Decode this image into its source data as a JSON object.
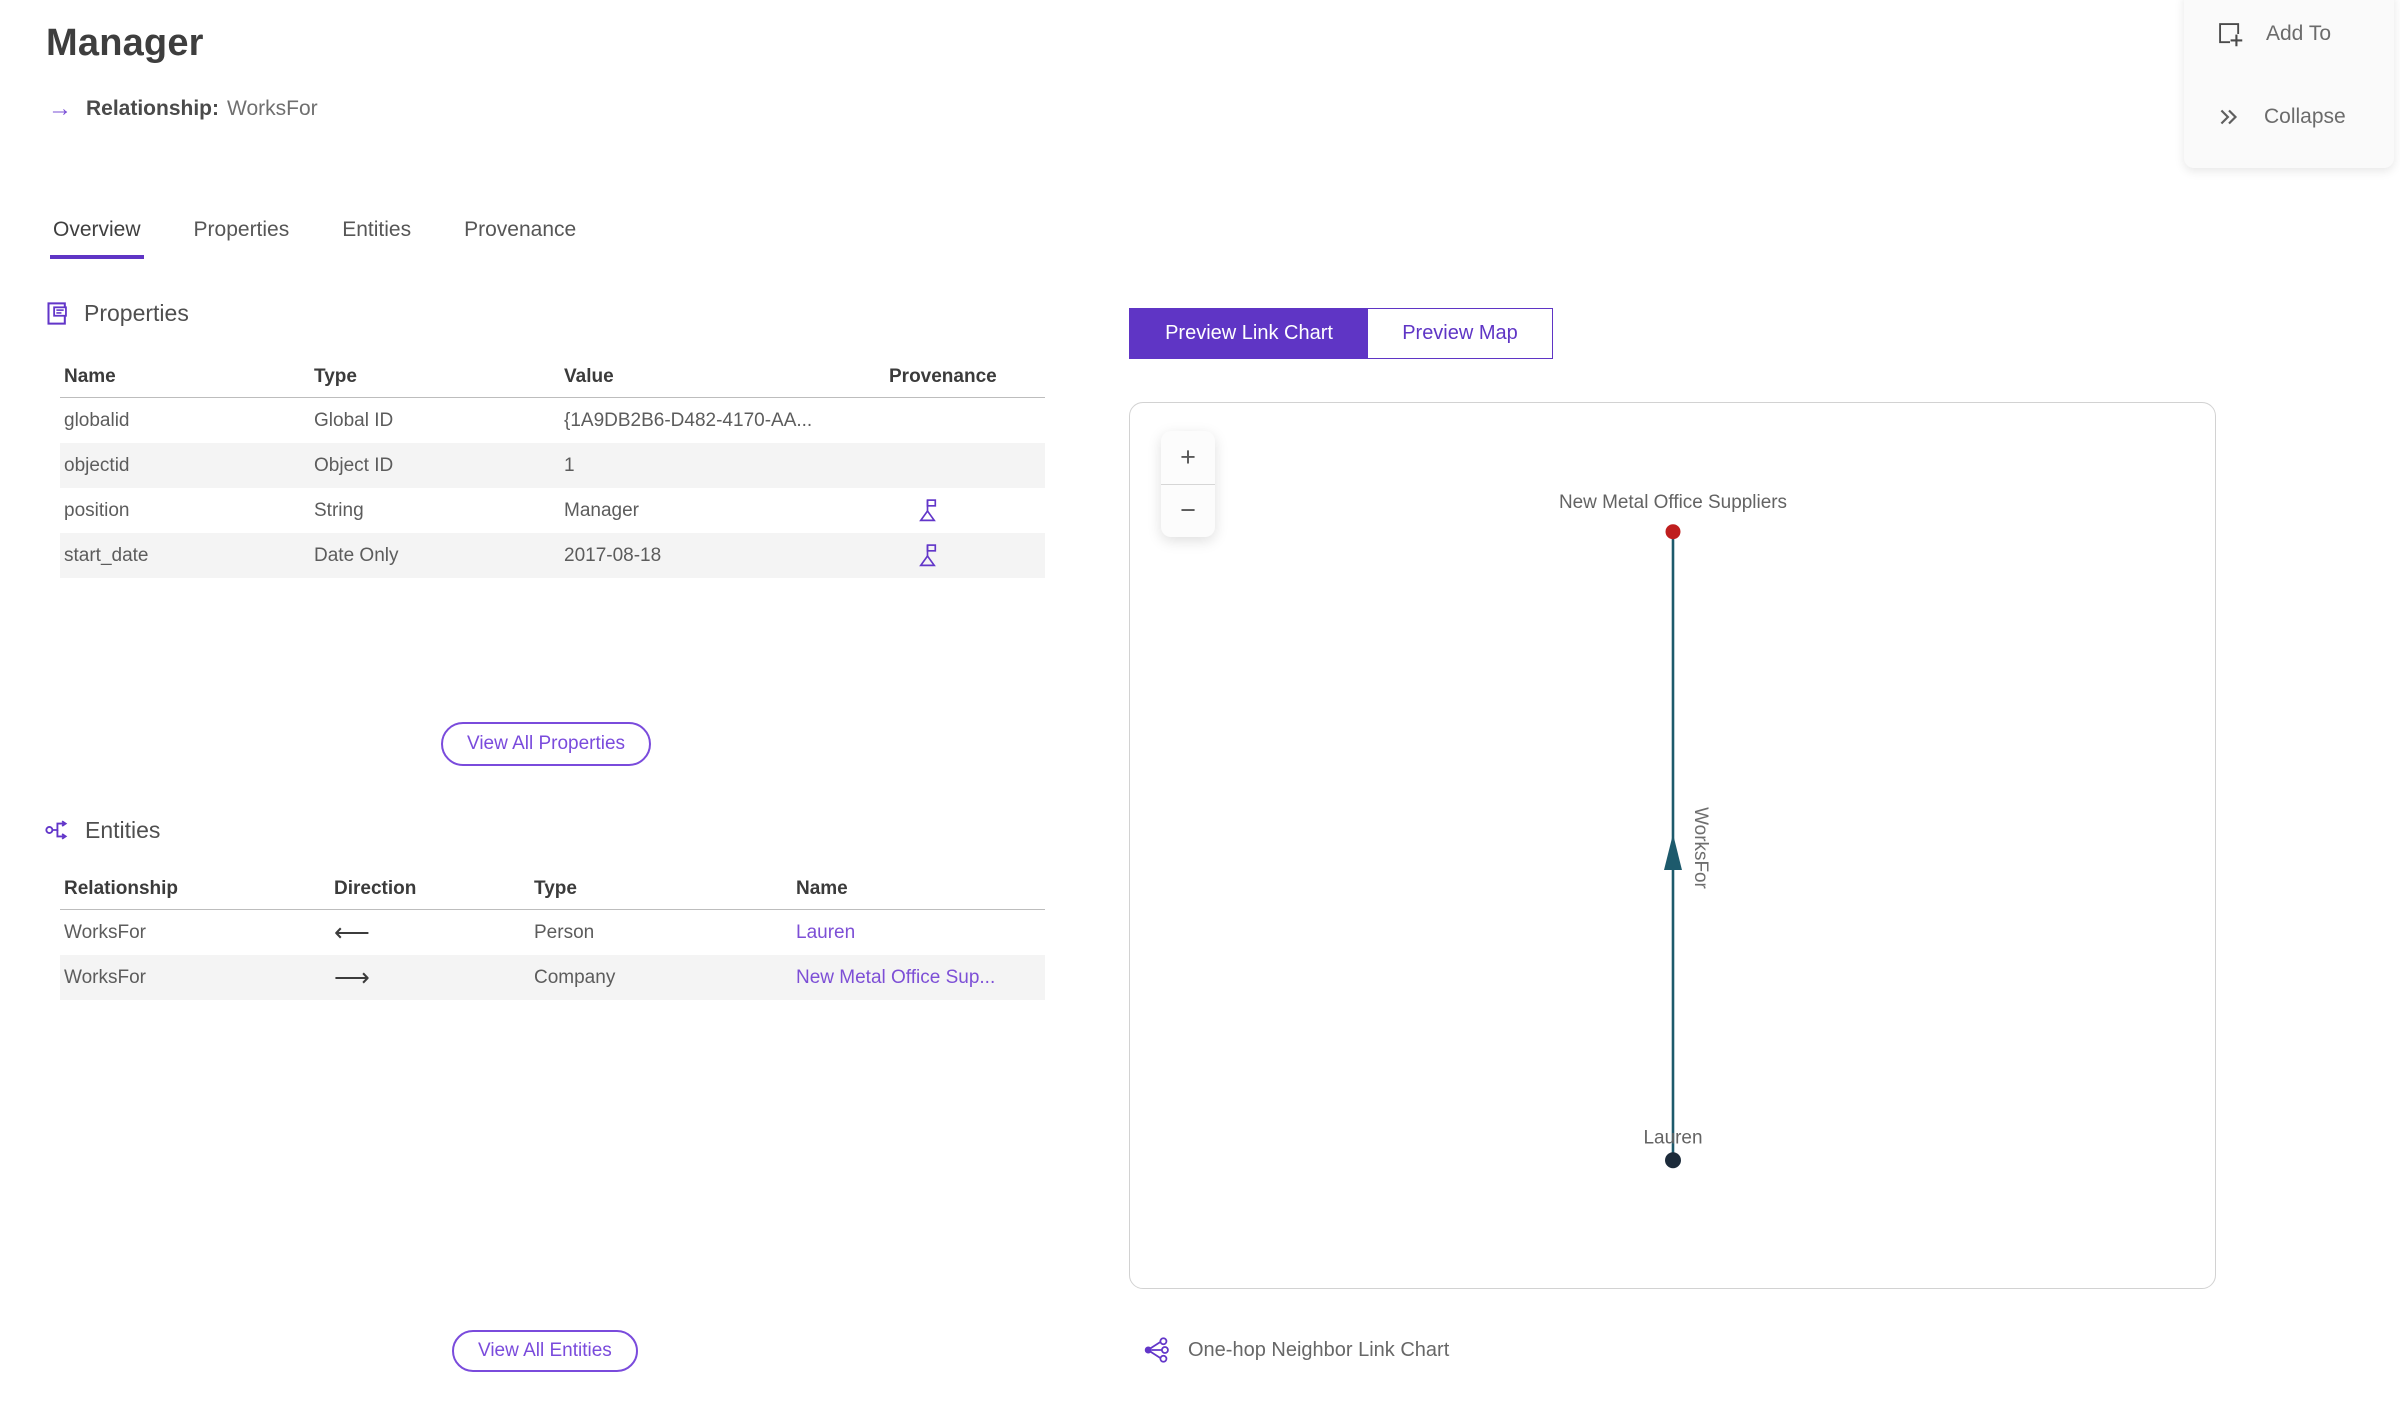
{
  "header": {
    "title": "Manager",
    "relationship_arrow": "→",
    "relationship_label": "Relationship:",
    "relationship_value": "WorksFor"
  },
  "actions": {
    "add_to": "Add To",
    "collapse": "Collapse"
  },
  "tabs": [
    {
      "label": "Overview",
      "active": true
    },
    {
      "label": "Properties",
      "active": false
    },
    {
      "label": "Entities",
      "active": false
    },
    {
      "label": "Provenance",
      "active": false
    }
  ],
  "properties_section": {
    "title": "Properties",
    "columns": [
      "Name",
      "Type",
      "Value",
      "Provenance"
    ],
    "rows": [
      {
        "name": "globalid",
        "type": "Global ID",
        "value": "{1A9DB2B6-D482-4170-AA...",
        "has_provenance": false
      },
      {
        "name": "objectid",
        "type": "Object ID",
        "value": "1",
        "has_provenance": false
      },
      {
        "name": "position",
        "type": "String",
        "value": "Manager",
        "has_provenance": true
      },
      {
        "name": "start_date",
        "type": "Date Only",
        "value": "2017-08-18",
        "has_provenance": true
      }
    ],
    "view_all_label": "View All Properties"
  },
  "entities_section": {
    "title": "Entities",
    "columns": [
      "Relationship",
      "Direction",
      "Type",
      "Name"
    ],
    "rows": [
      {
        "relationship": "WorksFor",
        "direction_glyph": "⟵",
        "type": "Person",
        "name": "Lauren"
      },
      {
        "relationship": "WorksFor",
        "direction_glyph": "⟶",
        "type": "Company",
        "name": "New Metal Office Sup..."
      }
    ],
    "view_all_label": "View All Entities"
  },
  "preview": {
    "toggle": [
      {
        "label": "Preview Link Chart",
        "active": true
      },
      {
        "label": "Preview Map",
        "active": false
      }
    ],
    "zoom_in": "+",
    "zoom_out": "−",
    "caption": "One-hop Neighbor Link Chart"
  },
  "chart_data": {
    "type": "link-chart",
    "nodes": [
      {
        "label": "New Metal Office Suppliers",
        "entity_type": "Company",
        "color": "#bf1e1e",
        "position": "top"
      },
      {
        "label": "Lauren",
        "entity_type": "Person",
        "color": "#1c2b3a",
        "position": "bottom"
      }
    ],
    "edge": {
      "label": "WorksFor",
      "from": "Lauren",
      "to": "New Metal Office Suppliers",
      "color": "#1d5a6c",
      "direction": "up"
    }
  },
  "colors": {
    "accent_purple": "#5f35c5",
    "link_purple": "#7d4fd6",
    "edge_teal": "#1d5a6c",
    "node_red": "#bf1e1e",
    "node_navy": "#1c2b3a"
  }
}
